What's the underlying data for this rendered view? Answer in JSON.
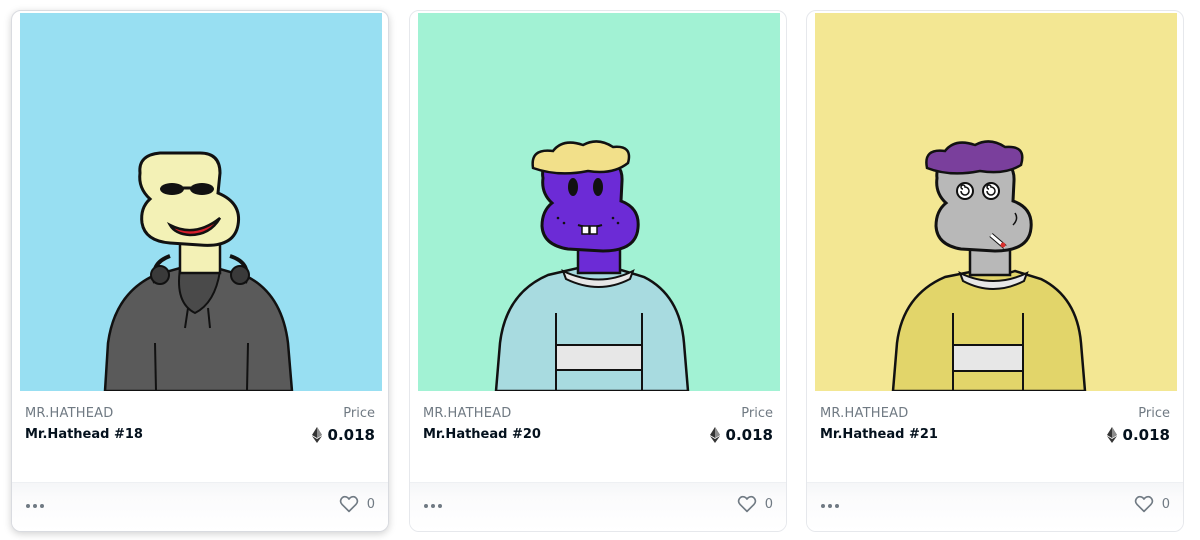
{
  "colors": {
    "card1_bg": "#98dff2",
    "card2_bg": "#a2f2d4",
    "card3_bg": "#f3e793",
    "text_primary": "#04111d",
    "text_secondary": "#707a83"
  },
  "cards": [
    {
      "collection": "MR.HATHEAD",
      "name": "Mr.Hathead #18",
      "price_label": "Price",
      "price": "0.018",
      "currency_icon": "ethereum-icon",
      "likes": "0",
      "more_icon": "more-dots-icon",
      "like_icon": "heart-icon"
    },
    {
      "collection": "MR.HATHEAD",
      "name": "Mr.Hathead #20",
      "price_label": "Price",
      "price": "0.018",
      "currency_icon": "ethereum-icon",
      "likes": "0",
      "more_icon": "more-dots-icon",
      "like_icon": "heart-icon"
    },
    {
      "collection": "MR.HATHEAD",
      "name": "Mr.Hathead #21",
      "price_label": "Price",
      "price": "0.018",
      "currency_icon": "ethereum-icon",
      "likes": "0",
      "more_icon": "more-dots-icon",
      "like_icon": "heart-icon"
    }
  ]
}
